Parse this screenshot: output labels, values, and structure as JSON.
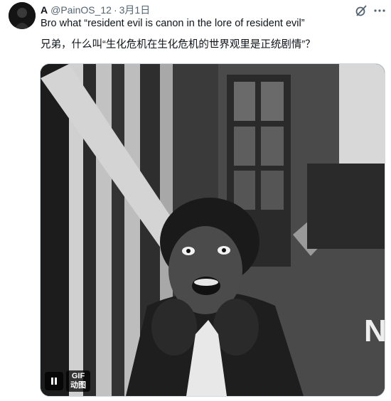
{
  "tweet": {
    "display_name": "A",
    "handle": "@PainOS_12",
    "separator": "·",
    "date": "3月1日",
    "text_line1": "Bro what “resident evil is canon in the lore of resident evil”",
    "text_line2": "兄弟，什么叫“生化危机在生化危机的世界观里是正统剧情”？"
  },
  "media": {
    "badge_en": "GIF",
    "badge_zh": "动图",
    "pause_icon": "pause-icon"
  },
  "icons": {
    "grok": "grok-icon",
    "more": "more-options-icon"
  },
  "colors": {
    "text": "#0f1419",
    "secondary_text": "#536471",
    "border": "#cfd9de"
  }
}
